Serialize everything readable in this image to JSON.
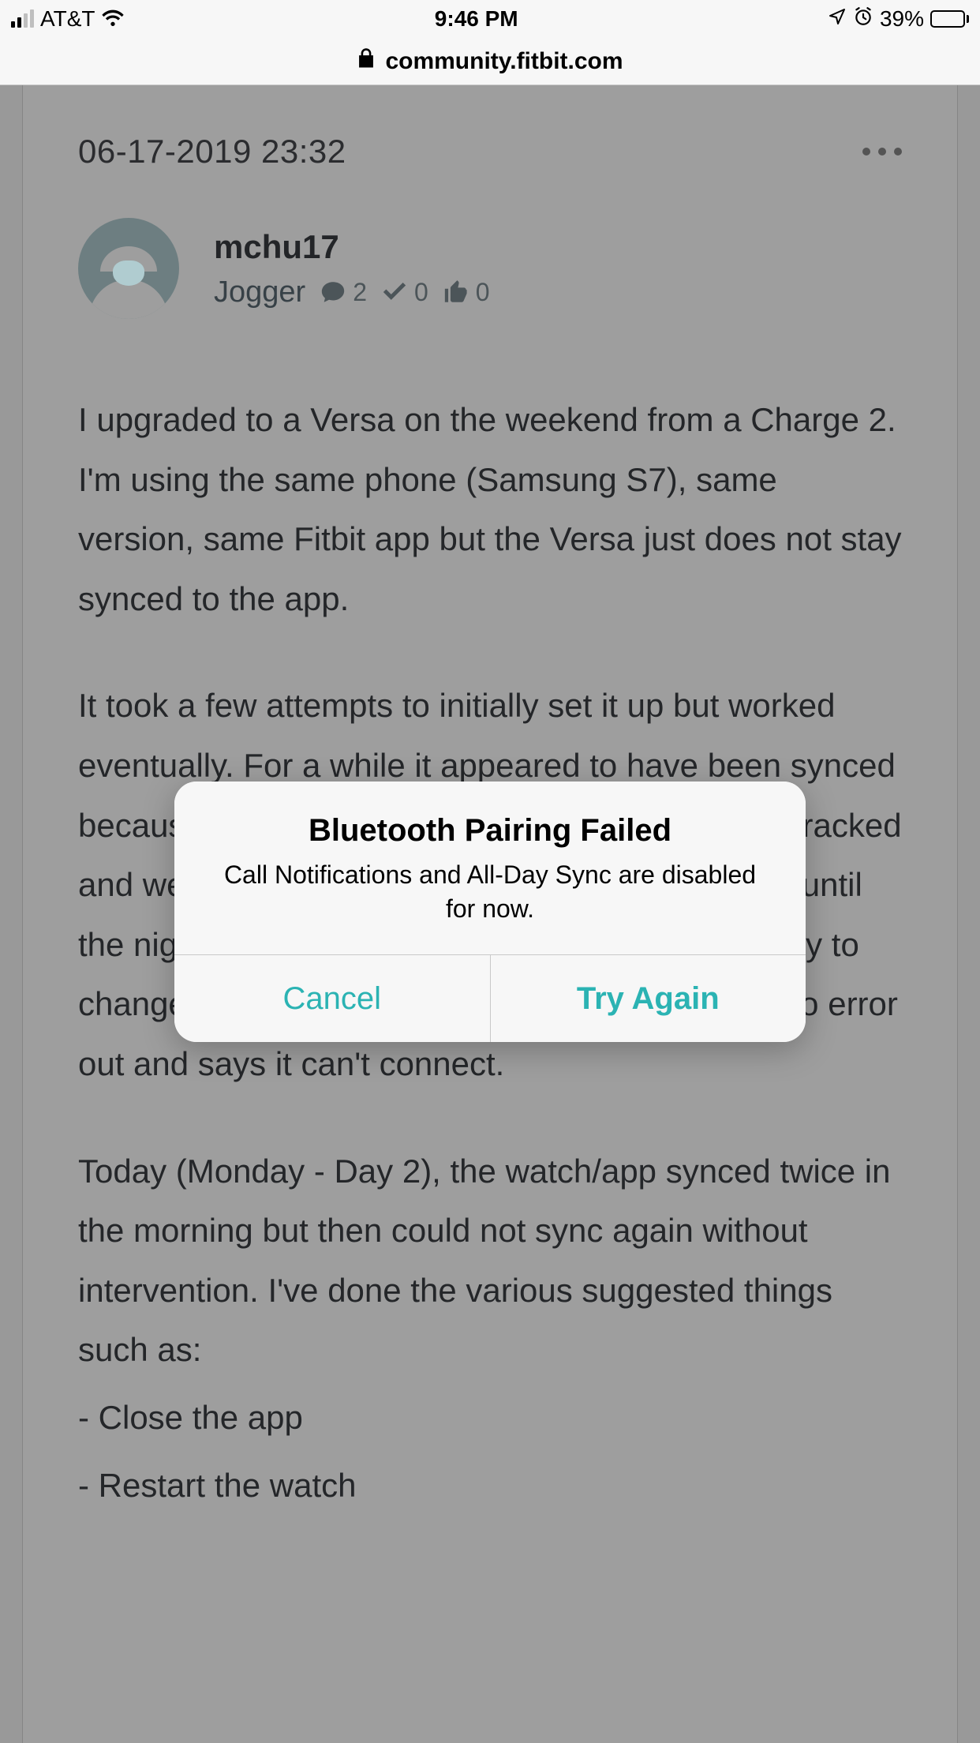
{
  "status": {
    "carrier": "AT&T",
    "time": "9:46 PM",
    "battery_pct": "39%"
  },
  "url": {
    "domain": "community.fitbit.com"
  },
  "post": {
    "timestamp": "06-17-2019 23:32",
    "username": "mchu17",
    "rank": "Jogger",
    "stats": {
      "comments": "2",
      "accepted": "0",
      "likes": "0"
    },
    "body": {
      "p1": "I upgraded to a Versa on the weekend from a Charge 2. I'm using the same phone (Samsung S7), same version, same Fitbit app but the Versa just does not stay synced to the app.",
      "p2": "It took a few attempts to initially set it up but worked eventually. For a while it appeared to have been synced because Versa showed notifications, steps were tracked and were on the app (Sunday - Day 1). That was until the night when I had some time to play with it to try to change clock face. It was then the Versa started to error out and says it can't connect.",
      "p3": "Today (Monday - Day 2), the watch/app synced twice in the morning but then could not sync again without intervention. I've done the various suggested things such as:",
      "l1": "- Close the app",
      "l2": "- Restart the watch"
    }
  },
  "alert": {
    "title": "Bluetooth Pairing Failed",
    "message": "Call Notifications and All-Day Sync are disabled for now.",
    "cancel": "Cancel",
    "try_again": "Try Again"
  }
}
